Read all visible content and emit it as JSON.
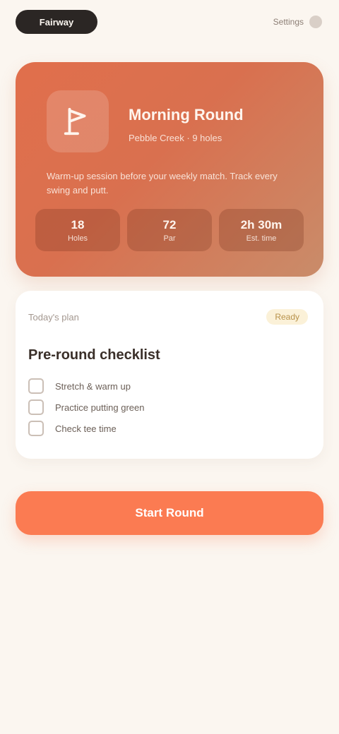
{
  "header": {
    "brand": "Fairway",
    "action_label": "Settings"
  },
  "hero": {
    "title": "Morning Round",
    "subtitle": "Pebble Creek · 9 holes",
    "description": "Warm-up session before your weekly match. Track every swing and putt.",
    "stats": [
      {
        "value": "18",
        "label": "Holes"
      },
      {
        "value": "72",
        "label": "Par"
      },
      {
        "value": "2h 30m",
        "label": "Est. time"
      }
    ]
  },
  "card": {
    "label": "Today's plan",
    "tag": "Ready",
    "title": "Pre-round checklist",
    "items": [
      {
        "text": "Stretch & warm up"
      },
      {
        "text": "Practice putting green"
      },
      {
        "text": "Check tee time"
      }
    ]
  },
  "cta": {
    "label": "Start Round"
  },
  "colors": {
    "accent": "#fb7b52",
    "hero": "#e16f4c",
    "background": "#fbf6f0"
  }
}
